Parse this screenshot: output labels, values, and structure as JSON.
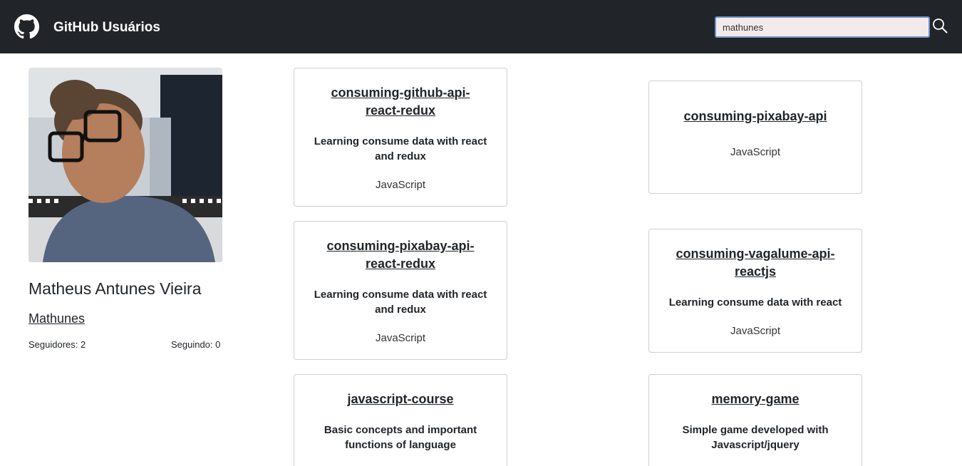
{
  "header": {
    "title": "GitHub Usuários",
    "search_value": "mathunes",
    "brand_icon": "github-logo-icon",
    "search_icon": "search-icon"
  },
  "profile": {
    "name": "Matheus Antunes Vieira",
    "login": "Mathunes",
    "followers": "Seguidores: 2",
    "following": "Seguindo: 0"
  },
  "repos": [
    {
      "name": "consuming-github-api-react-redux",
      "description": "Learning consume data with react and redux",
      "language": "JavaScript"
    },
    {
      "name": "consuming-pixabay-api",
      "description": "",
      "language": "JavaScript"
    },
    {
      "name": "consuming-pixabay-api-react-redux",
      "description": "Learning consume data with react and redux",
      "language": "JavaScript"
    },
    {
      "name": "consuming-vagalume-api-reactjs",
      "description": "Learning consume data with react",
      "language": "JavaScript"
    },
    {
      "name": "javascript-course",
      "description": "Basic concepts and important functions of language",
      "language": ""
    },
    {
      "name": "memory-game",
      "description": "Simple game developed with Javascript/jquery",
      "language": ""
    }
  ],
  "colors": {
    "navbar": "#212529",
    "search_bg": "#f3ebeb",
    "search_border": "#6f93c9"
  }
}
